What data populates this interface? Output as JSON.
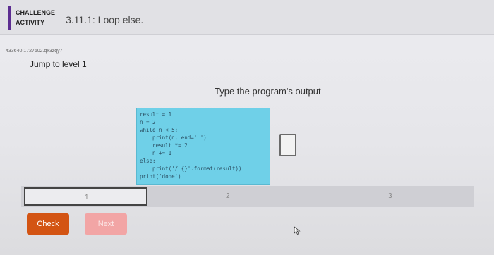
{
  "header": {
    "badge_line1": "CHALLENGE",
    "badge_line2": "ACTIVITY",
    "title": "3.11.1: Loop else."
  },
  "activity": {
    "code_id": "433640.1727602.qx3zqy7",
    "jump_label": "Jump to level 1",
    "prompt": "Type the program's output"
  },
  "code": {
    "lines": [
      "result = 1",
      "n = 2",
      "while n < 5:",
      "    print(n, end=' ')",
      "    result *= 2",
      "    n += 1",
      "else:",
      "    print('/ {}'.format(result))",
      "print('done')"
    ]
  },
  "answer": {
    "value": ""
  },
  "progress": {
    "levels": [
      "1",
      "2",
      "3"
    ],
    "current": 1
  },
  "buttons": {
    "check": "Check",
    "next": "Next"
  },
  "colors": {
    "accent": "#5c2d91",
    "code_bg": "#6fd0e8",
    "check_button": "#d35413",
    "next_button": "#f2a5a5"
  }
}
